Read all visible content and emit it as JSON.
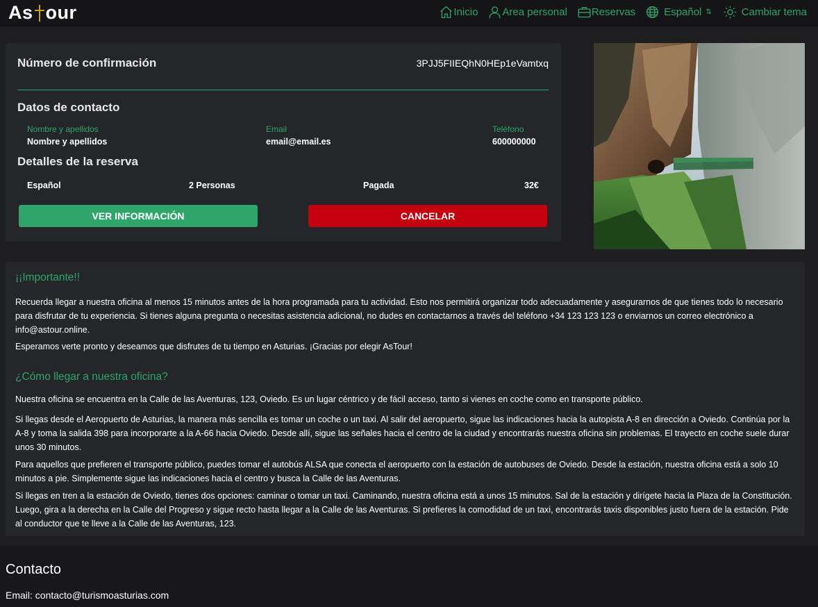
{
  "header": {
    "logo_prefix": "As",
    "logo_suffix": "our",
    "nav": [
      {
        "label": "Inicio",
        "icon": "home-icon"
      },
      {
        "label": "Area personal",
        "icon": "user-icon"
      },
      {
        "label": "Reservas",
        "icon": "briefcase-icon"
      },
      {
        "label": "Español",
        "icon": "globe-icon"
      },
      {
        "label": "Cambiar tema",
        "icon": "sun-icon"
      }
    ]
  },
  "booking": {
    "confirmation_label": "Número de confirmación",
    "confirmation_number": "3PJJ5FIIEQhN0HEp1eVamtxq",
    "contact_title": "Datos de contacto",
    "contact": {
      "name_label": "Nombre y apellidos",
      "name_value": "Nombre y apellidos",
      "email_label": "Email",
      "email_value": "email@email.es",
      "phone_label": "Teléfono",
      "phone_value": "600000000"
    },
    "details_title": "Detalles de la reserva",
    "details": {
      "language": "Español",
      "people": "2 Personas",
      "status": "Pagada",
      "price": "32€"
    },
    "info_button": "VER INFORMACIÓN",
    "cancel_button": "CANCELAR"
  },
  "info": {
    "important_title": "¡¡Importante!!",
    "important_p1": "Recuerda llegar a nuestra oficina al menos 15 minutos antes de la hora programada para tu actividad. Esto nos permitirá organizar todo adecuadamente y asegurarnos de que tienes todo lo necesario para disfrutar de tu experiencia. Si tienes alguna pregunta o necesitas asistencia adicional, no dudes en contactarnos a través del teléfono +34 123 123 123 o enviarnos un correo electrónico a info@astour.online.",
    "important_p2": "Esperamos verte pronto y deseamos que disfrutes de tu tiempo en Asturias. ¡Gracias por elegir AsTour!",
    "office_title": "¿Cómo llegar a nuestra oficina?",
    "office_p1": "Nuestra oficina se encuentra en la Calle de las Aventuras, 123, Oviedo. Es un lugar céntrico y de fácil acceso, tanto si vienes en coche como en transporte público.",
    "office_p2": "Si llegas desde el Aeropuerto de Asturias, la manera más sencilla es tomar un coche o un taxi. Al salir del aeropuerto, sigue las indicaciones hacia la autopista A-8 en dirección a Oviedo. Continúa por la A-8 y toma la salida 398 para incorporarte a la A-66 hacia Oviedo. Desde allí, sigue las señales hacia el centro de la ciudad y encontrarás nuestra oficina sin problemas. El trayecto en coche suele durar unos 30 minutos.",
    "office_p3": "Para aquellos que prefieren el transporte público, puedes tomar el autobús ALSA que conecta el aeropuerto con la estación de autobuses de Oviedo. Desde la estación, nuestra oficina está a solo 10 minutos a pie. Simplemente sigue las indicaciones hacia el centro y busca la Calle de las Aventuras.",
    "office_p4": "Si llegas en tren a la estación de Oviedo, tienes dos opciones: caminar o tomar un taxi. Caminando, nuestra oficina está a unos 15 minutos. Sal de la estación y dirígete hacia la Plaza de la Constitución. Luego, gira a la derecha en la Calle del Progreso y sigue recto hasta llegar a la Calle de las Aventuras. Si prefieres la comodidad de un taxi, encontrarás taxis disponibles justo fuera de la estación. Pide al conductor que te lleve a la Calle de las Aventuras, 123."
  },
  "footer": {
    "title": "Contacto",
    "email_line": "Email: contacto@turismoasturias.com"
  },
  "colors": {
    "accent": "#2ea56a",
    "danger": "#c5000f",
    "background": "#1e1e21",
    "panel": "#25262a",
    "logo_cross": "#c9a227"
  }
}
